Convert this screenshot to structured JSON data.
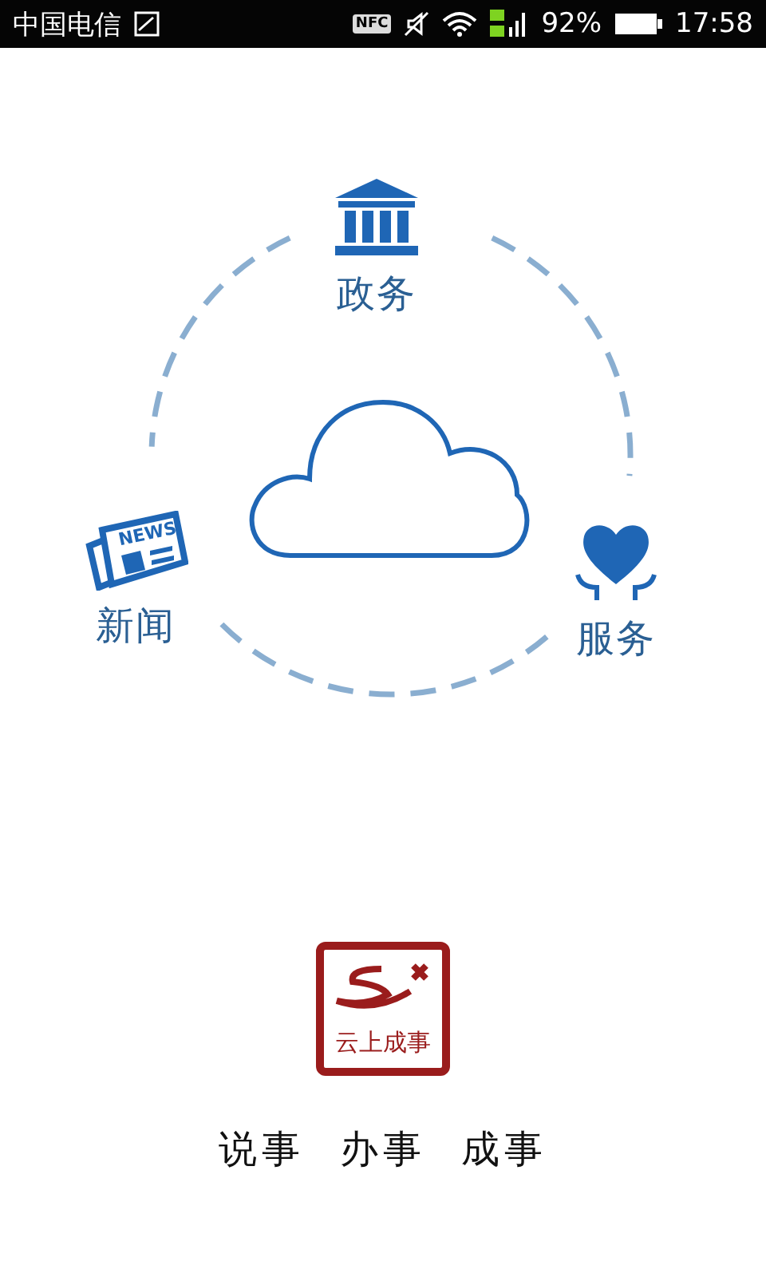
{
  "status_bar": {
    "carrier": "中国电信",
    "nfc": "NFC",
    "battery": "92%",
    "time": "17:58"
  },
  "diagram": {
    "nodes": [
      {
        "kind": "government",
        "label": "政务"
      },
      {
        "kind": "news",
        "label": "新闻",
        "icon_text": "NEWS"
      },
      {
        "kind": "service",
        "label": "服务"
      }
    ]
  },
  "logo": {
    "text": "云上成事"
  },
  "slogan": [
    "说事",
    "办事",
    "成事"
  ]
}
